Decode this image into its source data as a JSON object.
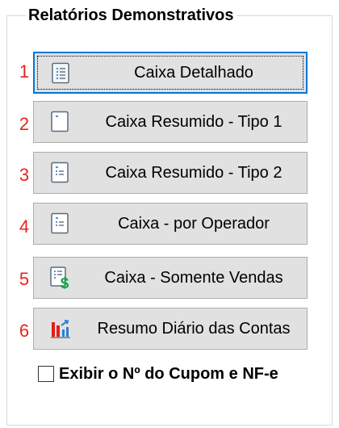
{
  "group": {
    "title": "Relatórios Demonstrativos"
  },
  "colors": {
    "row_number": "#e8231d",
    "focus_border": "#0078d7",
    "button_face": "#e1e1e1",
    "money_green": "#1aa34a",
    "chart_red": "#e0201a",
    "chart_blue": "#2a7fd4"
  },
  "reports": [
    {
      "number": "1",
      "label": "Caixa Detalhado",
      "icon": "report-list-icon",
      "focused": true
    },
    {
      "number": "2",
      "label": "Caixa Resumido - Tipo 1",
      "icon": "report-blank-icon",
      "focused": false
    },
    {
      "number": "3",
      "label": "Caixa Resumido - Tipo 2",
      "icon": "report-lines-icon",
      "focused": false
    },
    {
      "number": "4",
      "label": "Caixa - por Operador",
      "icon": "report-lines-icon",
      "focused": false
    },
    {
      "number": "5",
      "label": "Caixa - Somente Vendas",
      "icon": "report-money-icon",
      "focused": false
    },
    {
      "number": "6",
      "label": "Resumo Diário das Contas",
      "icon": "bar-chart-icon",
      "focused": false
    }
  ],
  "options": {
    "show_coupon_label": "Exibir o Nº do Cupom e NF-e",
    "show_coupon_checked": false
  }
}
